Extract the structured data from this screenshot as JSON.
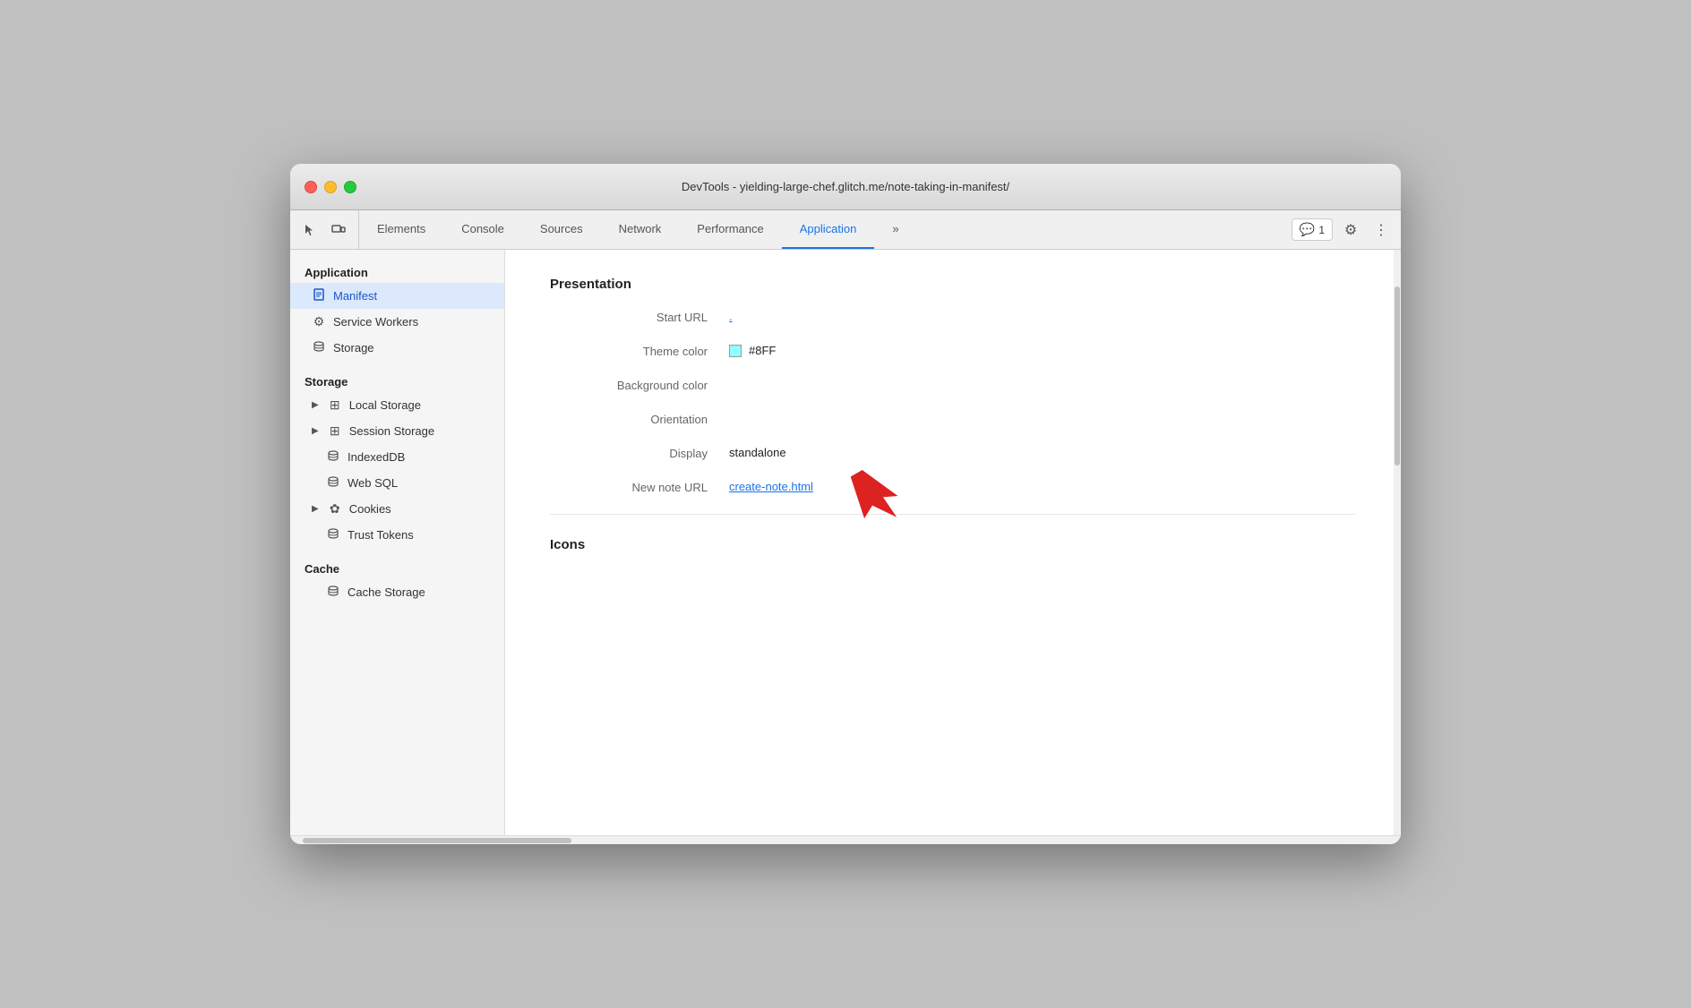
{
  "window": {
    "title": "DevTools - yielding-large-chef.glitch.me/note-taking-in-manifest/"
  },
  "toolbar": {
    "tabs": [
      {
        "id": "elements",
        "label": "Elements",
        "active": false
      },
      {
        "id": "console",
        "label": "Console",
        "active": false
      },
      {
        "id": "sources",
        "label": "Sources",
        "active": false
      },
      {
        "id": "network",
        "label": "Network",
        "active": false
      },
      {
        "id": "performance",
        "label": "Performance",
        "active": false
      },
      {
        "id": "application",
        "label": "Application",
        "active": true
      }
    ],
    "more_label": "»",
    "comments_count": "1",
    "settings_icon": "⚙",
    "more_icon": "⋮"
  },
  "sidebar": {
    "app_section": "Application",
    "app_items": [
      {
        "id": "manifest",
        "label": "Manifest",
        "icon": "doc",
        "active": true
      },
      {
        "id": "service-workers",
        "label": "Service Workers",
        "icon": "gear",
        "active": false
      },
      {
        "id": "storage",
        "label": "Storage",
        "icon": "db",
        "active": false
      }
    ],
    "storage_section": "Storage",
    "storage_items": [
      {
        "id": "local-storage",
        "label": "Local Storage",
        "icon": "grid",
        "arrow": true
      },
      {
        "id": "session-storage",
        "label": "Session Storage",
        "icon": "grid",
        "arrow": true
      },
      {
        "id": "indexed-db",
        "label": "IndexedDB",
        "icon": "db",
        "arrow": false
      },
      {
        "id": "web-sql",
        "label": "Web SQL",
        "icon": "db",
        "arrow": false
      },
      {
        "id": "cookies",
        "label": "Cookies",
        "icon": "cookie",
        "arrow": true
      },
      {
        "id": "trust-tokens",
        "label": "Trust Tokens",
        "icon": "db",
        "arrow": false
      }
    ],
    "cache_section": "Cache",
    "cache_items": [
      {
        "id": "cache-storage",
        "label": "Cache Storage",
        "icon": "db",
        "arrow": false
      }
    ]
  },
  "content": {
    "presentation_section": "Presentation",
    "properties": [
      {
        "id": "start-url",
        "label": "Start URL",
        "value": ".",
        "is_link": true
      },
      {
        "id": "theme-color",
        "label": "Theme color",
        "value": "#8FF",
        "has_swatch": true,
        "swatch_color": "#8FFFFF"
      },
      {
        "id": "bg-color",
        "label": "Background color",
        "value": ""
      },
      {
        "id": "orientation",
        "label": "Orientation",
        "value": ""
      },
      {
        "id": "display",
        "label": "Display",
        "value": "standalone"
      },
      {
        "id": "new-note-url",
        "label": "New note URL",
        "value": "create-note.html",
        "is_link": true
      }
    ],
    "icons_section": "Icons"
  }
}
